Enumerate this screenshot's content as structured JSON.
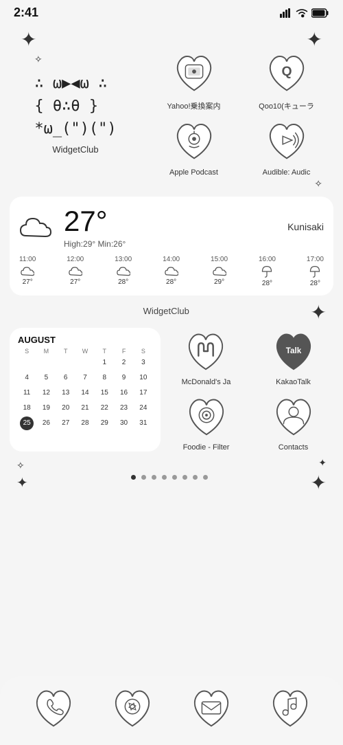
{
  "statusBar": {
    "time": "2:41",
    "signal": "▂▄▆█",
    "wifi": "wifi",
    "battery": "battery"
  },
  "topSparkles": {
    "left": "✦",
    "leftSm": "✧",
    "right": "✦"
  },
  "kaomoji": {
    "line1": "∴ ω▶◀ω ∴",
    "line2": "{ θ∴θ }",
    "line3": "*ω_(\")(\")",
    "label": "WidgetClub"
  },
  "topApps": [
    {
      "label": "Yahoo!乗換案内",
      "inner": "🚉"
    },
    {
      "label": "Qoo10(キューラ",
      "inner": "Q"
    },
    {
      "label": "Apple Podcast",
      "inner": "🎙"
    },
    {
      "label": "Audible: Audic",
      "inner": "◁"
    }
  ],
  "weather": {
    "location": "Kunisaki",
    "temp": "27°",
    "high": "High:29°",
    "min": "Min:26°",
    "forecast": [
      {
        "time": "11:00",
        "icon": "cloud",
        "temp": "27°"
      },
      {
        "time": "12:00",
        "icon": "cloud",
        "temp": "27°"
      },
      {
        "time": "13:00",
        "icon": "cloud",
        "temp": "28°"
      },
      {
        "time": "14:00",
        "icon": "cloud",
        "temp": "28°"
      },
      {
        "time": "15:00",
        "icon": "cloud",
        "temp": "29°"
      },
      {
        "time": "16:00",
        "icon": "umbrella",
        "temp": "28°"
      },
      {
        "time": "17:00",
        "icon": "umbrella",
        "temp": "28°"
      }
    ]
  },
  "calendar": {
    "month": "AUGUST",
    "headers": [
      "S",
      "M",
      "T",
      "W",
      "T",
      "F",
      "S"
    ],
    "weeks": [
      [
        "",
        "",
        "",
        "",
        "1",
        "2",
        "3"
      ],
      [
        "4",
        "5",
        "6",
        "7",
        "8",
        "9",
        "10"
      ],
      [
        "11",
        "12",
        "13",
        "14",
        "15",
        "16",
        "17"
      ],
      [
        "18",
        "19",
        "20",
        "21",
        "22",
        "23",
        "24"
      ],
      [
        "25",
        "26",
        "27",
        "28",
        "29",
        "30",
        "31"
      ]
    ],
    "today": "25"
  },
  "widgetClubLabel": "WidgetClub",
  "calendarApps": [
    {
      "label": "McDonald's Ja",
      "inner": "M"
    },
    {
      "label": "KakaoTalk",
      "inner": "Talk"
    },
    {
      "label": "Foodie - Filter",
      "inner": "⊙"
    },
    {
      "label": "Contacts",
      "inner": "👤"
    }
  ],
  "pageDots": {
    "total": 8,
    "active": 0
  },
  "bottomSparkles": {
    "topRight": "✦",
    "bottomLeft": "✦",
    "bottomLeftSm": "✧",
    "bottomRight": "✦"
  },
  "dock": [
    {
      "label": "Phone",
      "icon": "phone"
    },
    {
      "label": "Browser",
      "icon": "compass"
    },
    {
      "label": "Mail",
      "icon": "mail"
    },
    {
      "label": "Music",
      "icon": "music"
    }
  ]
}
